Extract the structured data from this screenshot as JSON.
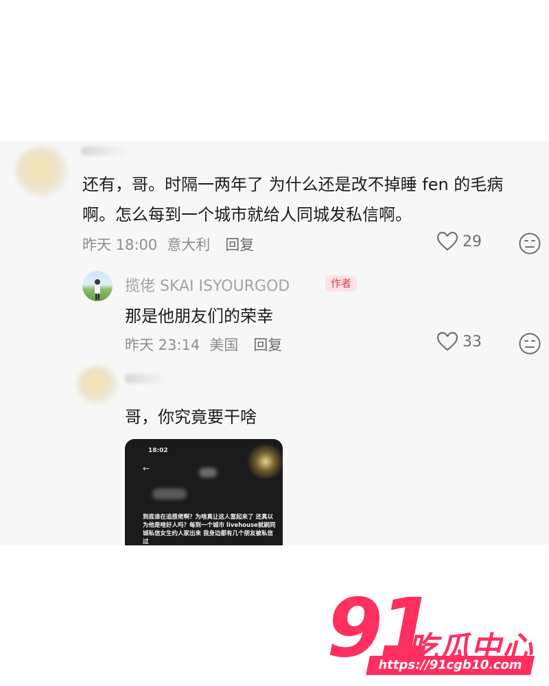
{
  "comment1": {
    "text_line1": "还有，哥。时隔一两年了 为什么还是改不掉睡 fen 的毛病",
    "text_line2": "啊。怎么每到一个城市就给人同城发私信啊。",
    "time": "昨天 18:00",
    "location": "意大利",
    "reply_label": "回复",
    "like_count": "29"
  },
  "reply1": {
    "username": "揽佬 SKAI ISYOURGOD",
    "badge": "作者",
    "text": "那是他朋友们的荣幸",
    "time": "昨天 23:14",
    "location": "美国",
    "reply_label": "回复",
    "like_count": "33"
  },
  "comment2": {
    "text": "哥，你究竟要干啥",
    "screenshot": {
      "status_time": "18:02",
      "back_glyph": "←",
      "message": "到底谁在追揽佬啊？为啥真让这人富起来了 还真以为他是啥好人吗？每到一个城市 livehouse就刷同城私信女生约人家出来 我身边都有几个朋友被私信过"
    }
  },
  "watermark": {
    "number": "91",
    "brand": "吃瓜中心",
    "url": "https://91cgb10.com"
  },
  "colors": {
    "brand_pink": "#ff2f5f",
    "badge_text": "#d8434f",
    "meta_gray": "#8d8d8d"
  },
  "icons": {
    "like": "heart-outline-icon",
    "dislike": "meh-face-icon"
  }
}
